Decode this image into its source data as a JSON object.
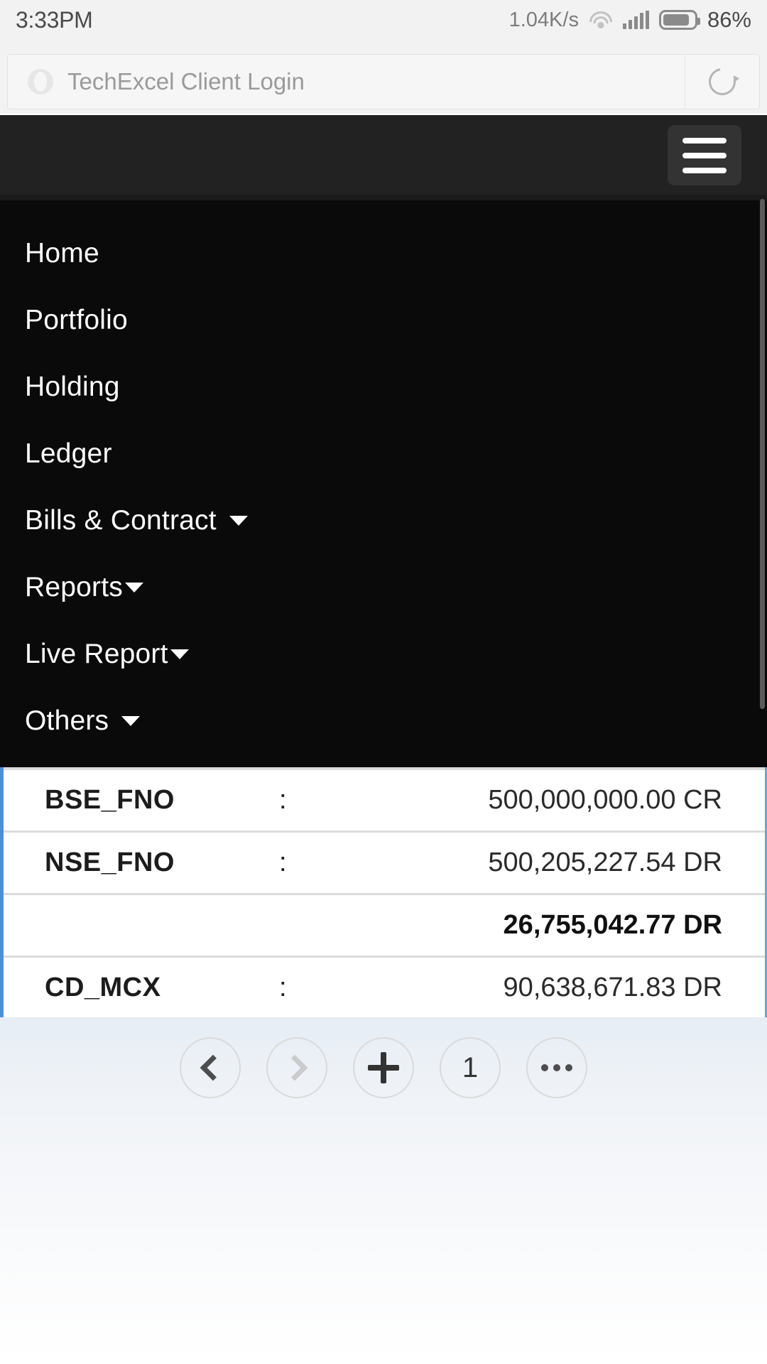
{
  "status_bar": {
    "time": "3:33PM",
    "network_speed": "1.04K/s",
    "battery_percent": "86%",
    "icons": [
      "wifi-icon",
      "signal-icon",
      "battery-icon"
    ]
  },
  "browser": {
    "address_bar": {
      "page_title": "TechExcel Client Login",
      "site_logo": "site-logo-icon",
      "reload": "reload-icon"
    },
    "bottom_nav": {
      "back_label": "‹",
      "forward_label": "›",
      "new_tab_label": "+",
      "tab_count": "1",
      "more_label": "•••"
    }
  },
  "app_header": {
    "menu_button": "hamburger-menu-icon"
  },
  "nav_menu": {
    "items": [
      {
        "label": "Home",
        "has_caret": false,
        "caret_gap": ""
      },
      {
        "label": "Portfolio",
        "has_caret": false,
        "caret_gap": ""
      },
      {
        "label": "Holding",
        "has_caret": false,
        "caret_gap": ""
      },
      {
        "label": "Ledger",
        "has_caret": false,
        "caret_gap": ""
      },
      {
        "label": "Bills & Contract",
        "has_caret": true,
        "caret_gap": "md"
      },
      {
        "label": "Reports",
        "has_caret": true,
        "caret_gap": "sm"
      },
      {
        "label": "Live Report",
        "has_caret": true,
        "caret_gap": "sm"
      },
      {
        "label": "Others",
        "has_caret": true,
        "caret_gap": "md"
      }
    ]
  },
  "data_card": {
    "accent_color": "#4a90d9",
    "separator": ":",
    "rows": [
      {
        "key": "BSE_FNO",
        "sep": ":",
        "value": "500,000,000.00 CR",
        "bold": false
      },
      {
        "key": "NSE_FNO",
        "sep": ":",
        "value": "500,205,227.54 DR",
        "bold": false
      },
      {
        "key": "",
        "sep": "",
        "value": "26,755,042.77 DR",
        "bold": true
      },
      {
        "key": "CD_MCX",
        "sep": ":",
        "value": "90,638,671.83 DR",
        "bold": false
      }
    ]
  }
}
